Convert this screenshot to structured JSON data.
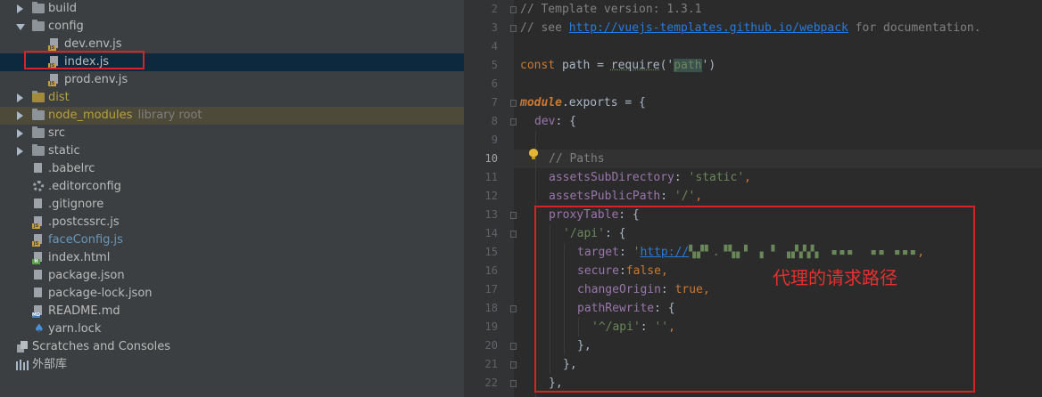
{
  "tree": {
    "items": [
      {
        "label": "build",
        "type": "folder",
        "expanded": false
      },
      {
        "label": "config",
        "type": "folder",
        "expanded": true
      },
      {
        "label": "dev.env.js",
        "type": "js"
      },
      {
        "label": "index.js",
        "type": "js",
        "selected": true
      },
      {
        "label": "prod.env.js",
        "type": "js"
      },
      {
        "label": "dist",
        "type": "folder",
        "expanded": false
      },
      {
        "label": "node_modules",
        "suffix": "library root",
        "type": "folder",
        "expanded": false
      },
      {
        "label": "src",
        "type": "folder",
        "expanded": false
      },
      {
        "label": "static",
        "type": "folder",
        "expanded": false
      },
      {
        "label": ".babelrc",
        "type": "file"
      },
      {
        "label": ".editorconfig",
        "type": "gear"
      },
      {
        "label": ".gitignore",
        "type": "file"
      },
      {
        "label": ".postcssrc.js",
        "type": "js"
      },
      {
        "label": "faceConfig.js",
        "type": "js"
      },
      {
        "label": "index.html",
        "type": "html"
      },
      {
        "label": "package.json",
        "type": "file"
      },
      {
        "label": "package-lock.json",
        "type": "file"
      },
      {
        "label": "README.md",
        "type": "md"
      },
      {
        "label": "yarn.lock",
        "type": "yarn"
      },
      {
        "label": "Scratches and Consoles",
        "type": "scratch"
      },
      {
        "label": "外部库",
        "type": "lib"
      }
    ]
  },
  "editor": {
    "line_numbers": [
      "2",
      "3",
      "4",
      "5",
      "6",
      "7",
      "8",
      "9",
      "10",
      "11",
      "12",
      "13",
      "14",
      "15",
      "16",
      "17",
      "18",
      "19",
      "20",
      "21",
      "22"
    ],
    "current_line": "10",
    "code": {
      "l2": "// Template version: 1.3.1",
      "l3_pre": "// see ",
      "l3_link": "http://vuejs-templates.github.io/webpack",
      "l3_post": " for documentation.",
      "l5_kw": "const",
      "l5_mid": " path = ",
      "l5_fn": "require",
      "l5_open": "('",
      "l5_str": "path",
      "l5_close": "')",
      "l7_kw": "module",
      "l7_rest": ".exports = {",
      "l8_prop": "dev",
      "l8_rest": ": {",
      "l10": "// Paths",
      "l11_prop": "assetsSubDirectory",
      "l11_sep": ": ",
      "l11_str": "'static'",
      "l11_end": ",",
      "l12_prop": "assetsPublicPath",
      "l12_sep": ": ",
      "l12_str": "'/'",
      "l12_end": ",",
      "l13_prop": "proxyTable",
      "l13_rest": ": {",
      "l14_str": "'/api'",
      "l14_rest": ": {",
      "l15_prop": "target",
      "l15_sep": ": ",
      "l15_str": "'",
      "l15_link": "http://",
      "l15_blur": "▚▞▘.▝▚▖▘ ▖▝ ▗▞▞▞▖ ▪▪▪  ▪▪ ▪▪▪",
      "l15_end": ",",
      "l16_prop": "secure",
      "l16_sep": ":",
      "l16_kw": "false",
      "l16_end": ",",
      "l17_prop": "changeOrigin",
      "l17_sep": ": ",
      "l17_kw": "true",
      "l17_end": ",",
      "l18_prop": "pathRewrite",
      "l18_rest": ": {",
      "l19_str1": "'^/api'",
      "l19_sep": ": ",
      "l19_str2": "''",
      "l19_end": ",",
      "l20": "},",
      "l21": "},",
      "l22": "},"
    },
    "annotation": "代理的请求路径"
  },
  "colors": {
    "highlight_border": "#d42427",
    "annotation_text": "#e3312f",
    "selected_row": "#0d293e"
  }
}
